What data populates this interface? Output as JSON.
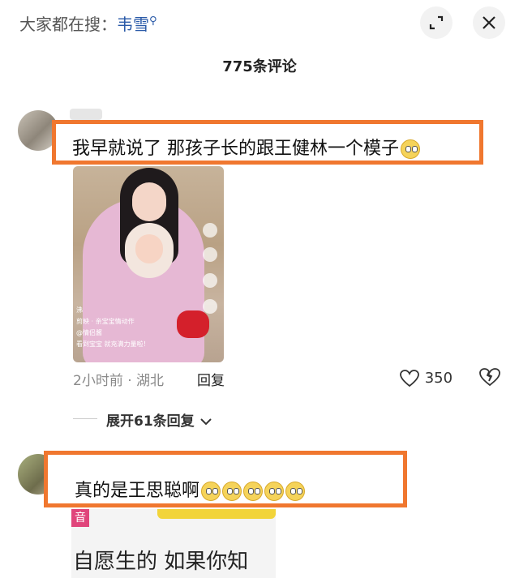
{
  "header": {
    "search_prefix": "大家都在搜：",
    "search_keyword": "韦雪",
    "search_suffix_icon": "search-icon",
    "expand_icon": "expand-icon",
    "close_icon": "close-icon"
  },
  "comment_count": "775条评论",
  "comments": [
    {
      "text": "我早就说了 那孩子长的跟王健林一个模子",
      "emoji": [
        "sweat-emoji"
      ],
      "time_location": "2小时前 · 湖北",
      "reply_label": "回复",
      "likes": "350",
      "expand_replies": "展开61条回复",
      "image_captions": [
        "沸",
        "剪映 · 亲宝宝情动作",
        "@情侣酱",
        "看到宝宝 就充满力量啦！"
      ]
    },
    {
      "text": "真的是王思聪啊",
      "emoji": [
        "shock-emoji",
        "shock-emoji",
        "shock-emoji",
        "shock-emoji",
        "shock-emoji"
      ],
      "image_tag": "音",
      "image_text": "自愿生的 如果你知"
    }
  ],
  "colors": {
    "highlight": "#f0772f",
    "keyword": "#2a5aa8"
  }
}
